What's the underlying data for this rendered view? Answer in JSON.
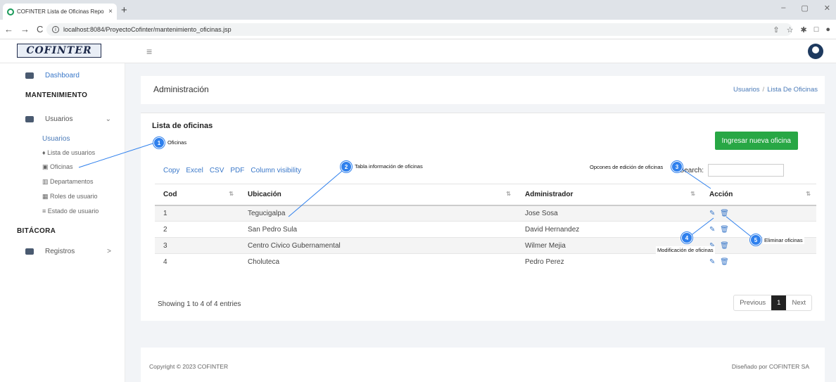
{
  "browser": {
    "tab_title": "COFINTER Lista de Oficinas Repo",
    "tab_close": "×",
    "new_tab": "+",
    "url": "localhost:8084/ProyectoCofinter/mantenimiento_oficinas.jsp",
    "nav_back": "←",
    "nav_forward": "→",
    "nav_reload": "C",
    "win_min": "–",
    "win_max": "▢",
    "win_close": "✕",
    "icon_share": "⇧",
    "icon_star": "☆",
    "icon_ext": "✱",
    "icon_split": "□",
    "icon_profile": "●"
  },
  "header": {
    "logo_text": "COFINTER",
    "menu_icon": "≡"
  },
  "sidebar": {
    "dashboard": "Dashboard",
    "section_mantenimiento": "MANTENIMIENTO",
    "usuarios_group": "Usuarios",
    "usuarios_caret": "⌄",
    "usuarios_label": "Usuarios",
    "items": [
      {
        "label": "Lista de usuarios"
      },
      {
        "label": "Oficinas"
      },
      {
        "label": "Departamentos"
      },
      {
        "label": "Roles de usuario"
      },
      {
        "label": "Estado de usuario"
      }
    ],
    "section_bitacora": "BITÁCORA",
    "registros": "Registros",
    "registros_caret": ">"
  },
  "page": {
    "title": "Administración",
    "breadcrumb_parent": "Usuarios",
    "breadcrumb_sep": "/",
    "breadcrumb_current": "Lista De Oficinas"
  },
  "card": {
    "title": "Lista de oficinas",
    "add_button": "Ingresar nueva oficina",
    "tools": [
      "Copy",
      "Excel",
      "CSV",
      "PDF",
      "Column visibility"
    ],
    "search_label": "Search:"
  },
  "table": {
    "headers": [
      "Cod",
      "Ubicación",
      "Administrador",
      "Acción"
    ],
    "sort_icon": "⇅",
    "rows": [
      {
        "cod": "1",
        "ubicacion": "Tegucigalpa",
        "admin": "Jose Sosa"
      },
      {
        "cod": "2",
        "ubicacion": "San Pedro Sula",
        "admin": "David Hernandez"
      },
      {
        "cod": "3",
        "ubicacion": "Centro Civico Gubernamental",
        "admin": "Wilmer Mejia"
      },
      {
        "cod": "4",
        "ubicacion": "Choluteca",
        "admin": "Pedro Perez"
      }
    ],
    "action_icons": "✎ 🗑"
  },
  "pagination": {
    "info": "Showing 1 to 4 of 4 entries",
    "previous": "Previous",
    "page": "1",
    "next": "Next"
  },
  "footer": {
    "copyright": "Copyright © 2023 COFINTER",
    "designed_by": "Diseñado por COFINTER SA"
  },
  "annotations": [
    {
      "num": "1",
      "text": "Oficinas"
    },
    {
      "num": "2",
      "text": "Tabla información de oficinas"
    },
    {
      "num": "3",
      "text": "Opcones de edición de oficinas"
    },
    {
      "num": "4",
      "text": "Modificación de oficinas"
    },
    {
      "num": "5",
      "text": "Eliminar oficinas"
    }
  ]
}
